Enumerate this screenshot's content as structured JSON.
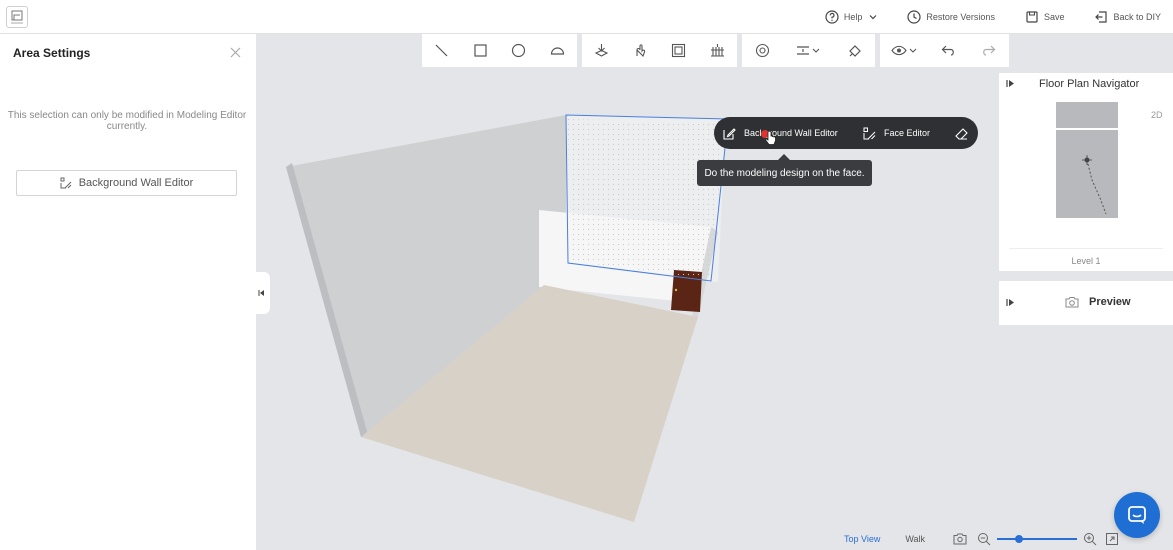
{
  "topbar": {
    "help_label": "Help",
    "restore_label": "Restore Versions",
    "save_label": "Save",
    "back_label": "Back to DIY"
  },
  "sidebar": {
    "title": "Area Settings",
    "note": "This selection can only be modified in Modeling Editor currently.",
    "button_label": "Background Wall Editor"
  },
  "toolbar_icons": [
    "line-icon",
    "rectangle-icon",
    "circle-icon",
    "arc-icon",
    "extrude-icon",
    "hand-icon",
    "frame-icon",
    "fence-icon",
    "snap-icon",
    "align-icon",
    "paint-icon",
    "visibility-icon",
    "undo-icon",
    "redo-icon"
  ],
  "context_toolbar": {
    "background_wall_label": "Background Wall Editor",
    "face_editor_label": "Face Editor"
  },
  "tooltip": {
    "text": "Do the modeling design on the face."
  },
  "navigator": {
    "title": "Floor Plan Navigator",
    "mode_label": "2D",
    "level_label": "Level 1"
  },
  "preview": {
    "label": "Preview"
  },
  "bottombar": {
    "top_view_label": "Top View",
    "walk_label": "Walk",
    "zoom_fraction": 0.27
  },
  "colors": {
    "accent": "#2a6fd6",
    "context_bg": "#2e3033",
    "chat": "#1f6ed4",
    "door": "#5a2515"
  }
}
